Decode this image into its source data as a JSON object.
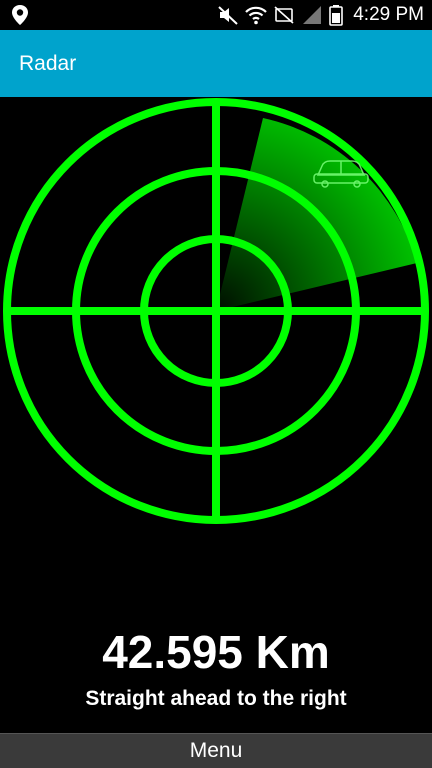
{
  "status_bar": {
    "time": "4:29 PM",
    "icons": [
      "location-pin-icon",
      "mute-icon",
      "wifi-icon",
      "no-sim-icon",
      "signal-icon",
      "battery-icon"
    ]
  },
  "app_bar": {
    "title": "Radar",
    "color": "#00a3cc"
  },
  "radar": {
    "color": "#00ff00",
    "target_icon": "car-icon"
  },
  "readout": {
    "distance": "42.595 Km",
    "direction": "Straight ahead to the right"
  },
  "menu": {
    "label": "Menu"
  }
}
